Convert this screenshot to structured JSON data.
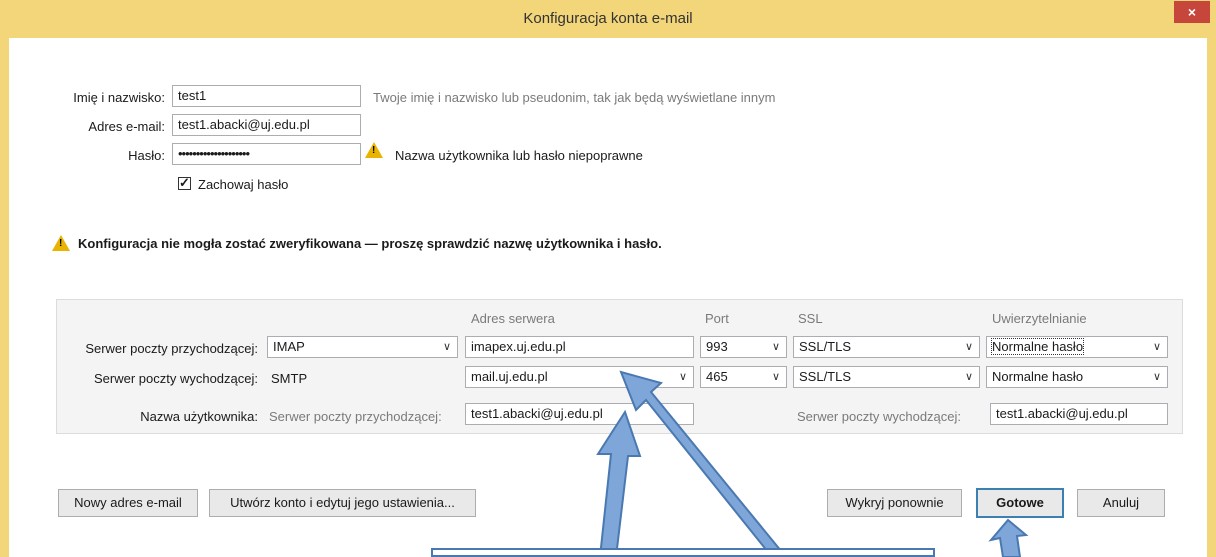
{
  "window": {
    "title": "Konfiguracja konta e-mail",
    "close": "×"
  },
  "form": {
    "name_label": "Imię i nazwisko:",
    "name_value": "test1",
    "name_hint": "Twoje imię i nazwisko lub pseudonim, tak jak będą wyświetlane innym",
    "email_label": "Adres e-mail:",
    "email_value": "test1.abacki@uj.edu.pl",
    "password_label": "Hasło:",
    "password_value": "••••••••••••••••••••",
    "password_warning": "Nazwa użytkownika lub hasło niepoprawne",
    "remember_label": "Zachowaj hasło",
    "remember_checked": true
  },
  "verification_warning": "Konfiguracja nie mogła zostać zweryfikowana — proszę sprawdzić nazwę użytkownika i hasło.",
  "server_table": {
    "headers": {
      "address": "Adres serwera",
      "port": "Port",
      "ssl": "SSL",
      "auth": "Uwierzytelnianie"
    },
    "incoming": {
      "label": "Serwer poczty przychodzącej:",
      "protocol": "IMAP",
      "address": "imapex.uj.edu.pl",
      "port": "993",
      "ssl": "SSL/TLS",
      "auth": "Normalne hasło"
    },
    "outgoing": {
      "label": "Serwer poczty wychodzącej:",
      "protocol": "SMTP",
      "address": "mail.uj.edu.pl",
      "port": "465",
      "ssl": "SSL/TLS",
      "auth": "Normalne hasło"
    },
    "username": {
      "label": "Nazwa użytkownika:",
      "incoming_label": "Serwer poczty przychodzącej:",
      "incoming_value": "test1.abacki@uj.edu.pl",
      "outgoing_label": "Serwer poczty wychodzącej:",
      "outgoing_value": "test1.abacki@uj.edu.pl"
    }
  },
  "buttons": {
    "new_email": "Nowy adres e-mail",
    "create_edit": "Utwórz konto i edytuj jego ustawienia...",
    "retest": "Wykryj ponownie",
    "done": "Gotowe",
    "cancel": "Anuluj"
  },
  "colors": {
    "titlebar": "#f3d57a",
    "close": "#c7463b",
    "arrow": "#4a78b0"
  },
  "icons": {
    "warning": "warning-icon",
    "chevron": "chevron-down-icon"
  }
}
